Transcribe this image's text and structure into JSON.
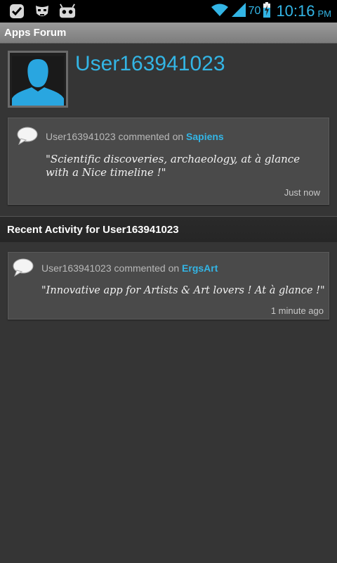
{
  "status_bar": {
    "battery": "70",
    "time": "10:16",
    "ampm": "PM",
    "accent": "#33b5e5",
    "icons": [
      "check-notification-icon",
      "mask-icon",
      "robot-icon",
      "wifi-icon",
      "signal-icon",
      "battery-charging-icon"
    ]
  },
  "action_bar": {
    "title": "Apps Forum"
  },
  "profile": {
    "username": "User163941023",
    "latest": {
      "user": "User163941023",
      "verb": " commented on ",
      "app": "Sapiens",
      "quote": "\"Scientific discoveries, archaeology, at à glance with a Nice timeline !\"",
      "time": "Just now"
    }
  },
  "recent": {
    "header": "Recent Activity for User163941023",
    "items": [
      {
        "user": "User163941023",
        "verb": " commented on ",
        "app": "ErgsArt",
        "quote": "\"Innovative app for Artists & Art lovers ! At à glance !\"",
        "time": "1 minute ago"
      }
    ]
  }
}
